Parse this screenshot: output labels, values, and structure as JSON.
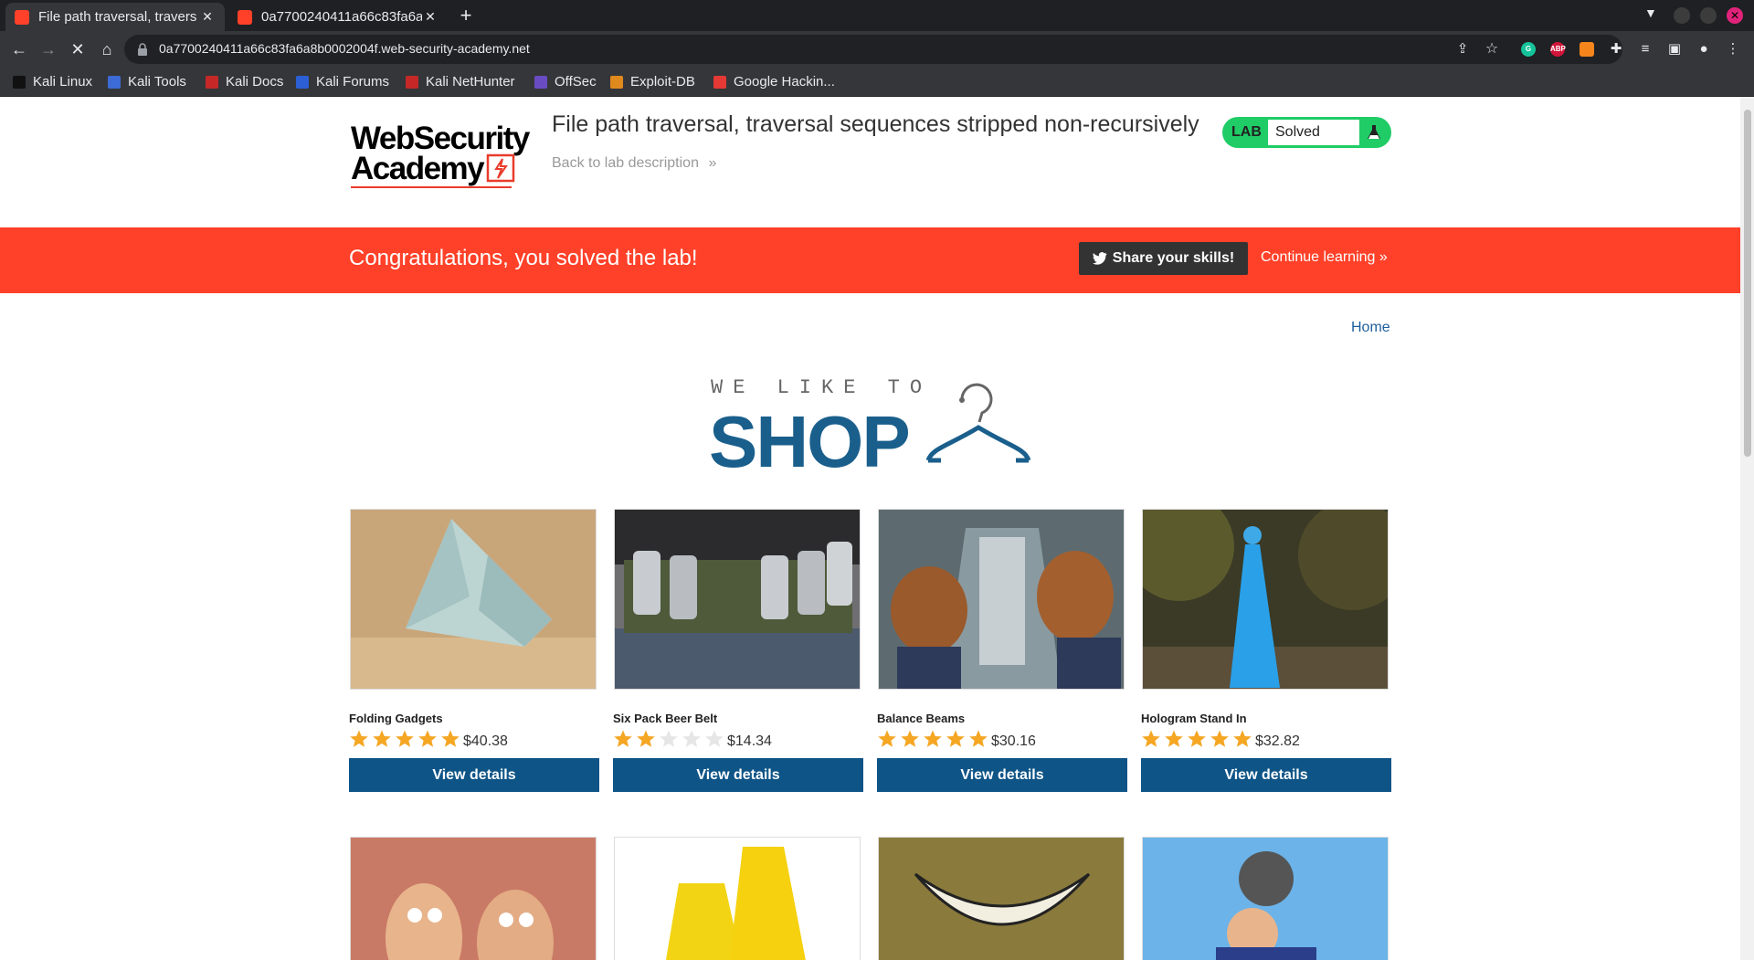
{
  "browser": {
    "tabs": [
      {
        "title": "File path traversal, travers",
        "active": true
      },
      {
        "title": "0a7700240411a66c83fa6a",
        "active": false
      }
    ],
    "url": "0a7700240411a66c83fa6a8b0002004f.web-security-academy.net",
    "bookmarks": [
      "Kali Linux",
      "Kali Tools",
      "Kali Docs",
      "Kali Forums",
      "Kali NetHunter",
      "OffSec",
      "Exploit-DB",
      "Google Hackin..."
    ]
  },
  "header": {
    "logo_line1": "WebSecurity",
    "logo_line2": "Academy",
    "lab_title": "File path traversal, traversal sequences stripped non-recursively",
    "back_link": "Back to lab description",
    "lab_label": "LAB",
    "lab_status": "Solved"
  },
  "banner": {
    "message": "Congratulations, you solved the lab!",
    "share_label": "Share your skills!",
    "continue_label": "Continue learning"
  },
  "nav": {
    "home": "Home"
  },
  "shop_logo": {
    "line1": "WE LIKE TO",
    "line2": "SHOP"
  },
  "products": [
    {
      "name": "Folding Gadgets",
      "rating": 5,
      "price": "$40.38"
    },
    {
      "name": "Six Pack Beer Belt",
      "rating": 2,
      "price": "$14.34"
    },
    {
      "name": "Balance Beams",
      "rating": 5,
      "price": "$30.16"
    },
    {
      "name": "Hologram Stand In",
      "rating": 5,
      "price": "$32.82"
    }
  ],
  "view_details_label": "View details",
  "colors": {
    "banner": "#ff4129",
    "button": "#0e5487",
    "lab_green": "#1fcc66",
    "star": "#f5a623"
  }
}
